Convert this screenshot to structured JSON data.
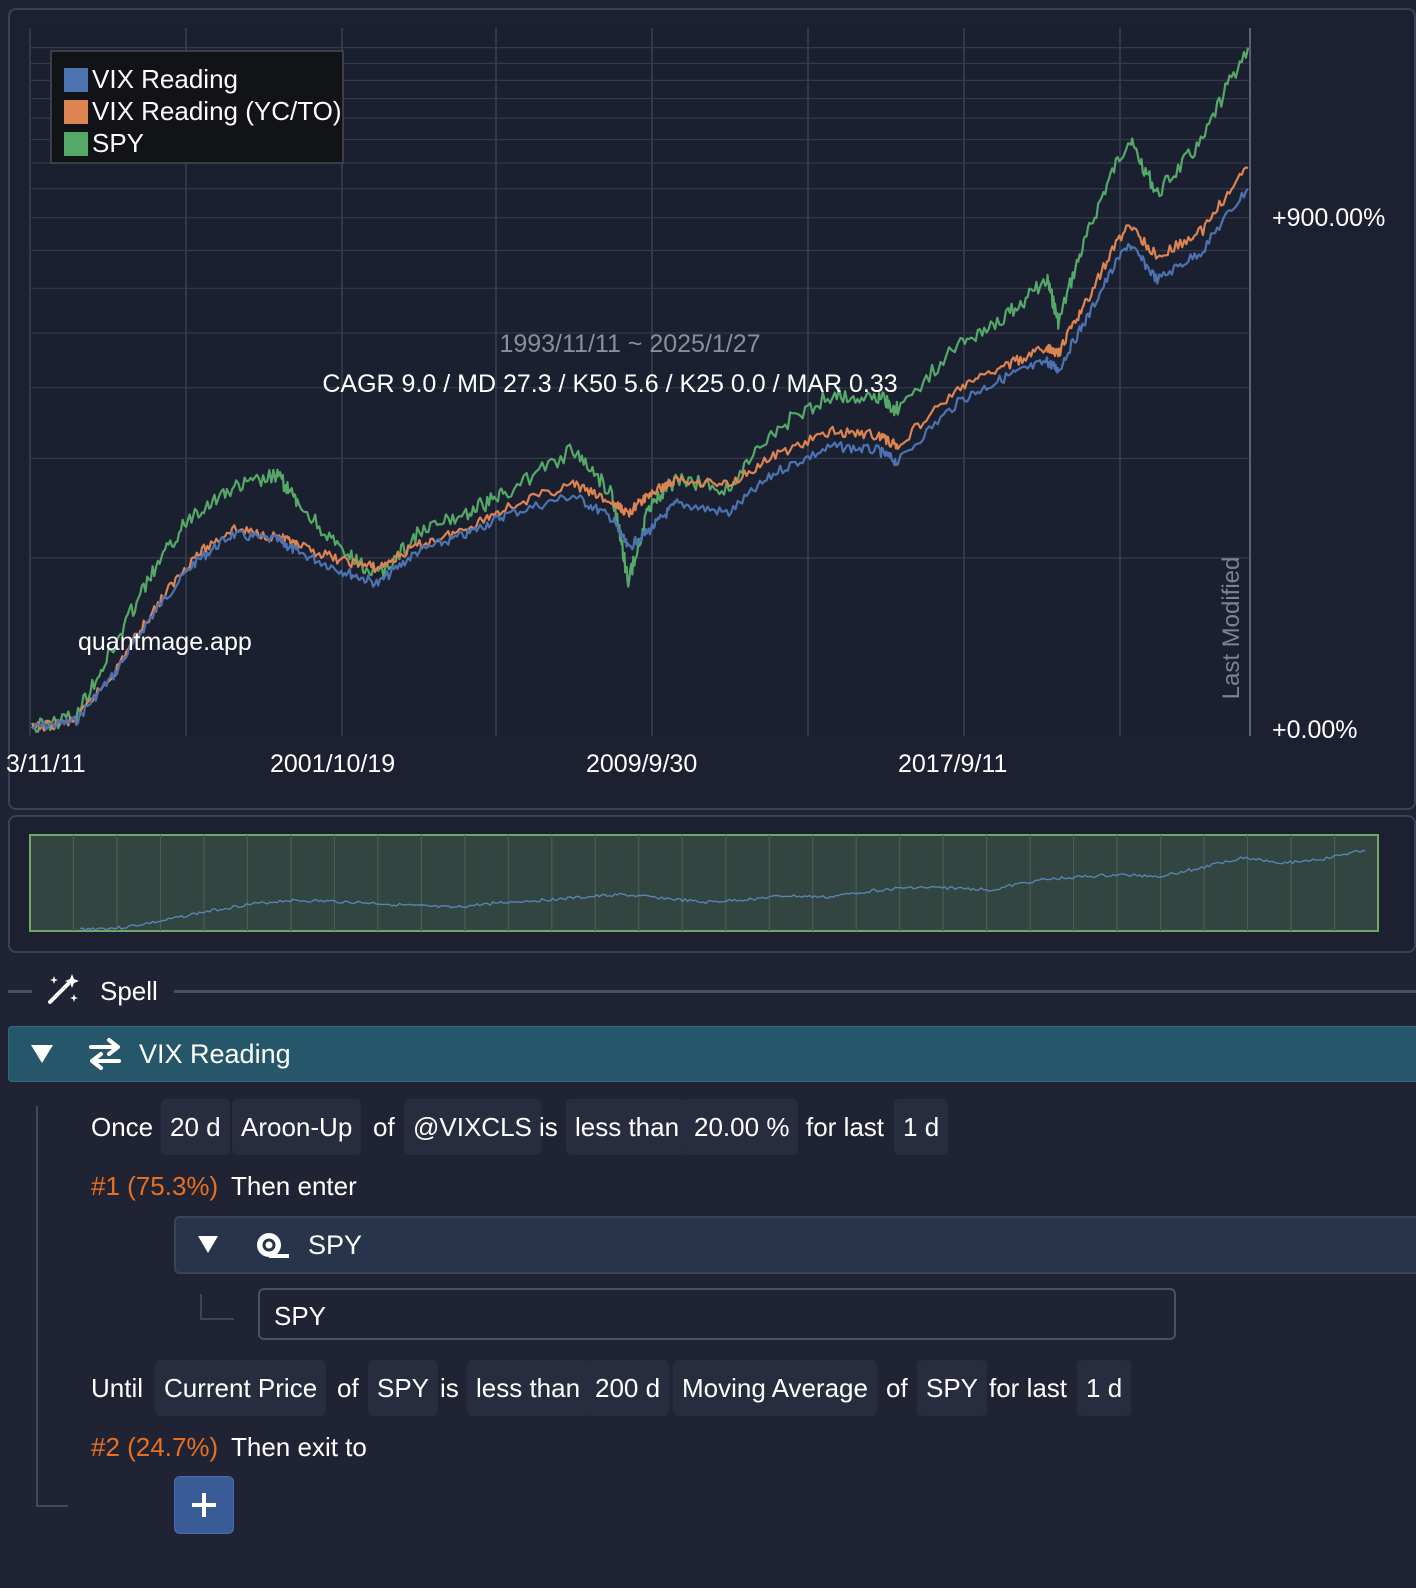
{
  "chart": {
    "legend": [
      {
        "label": "VIX Reading",
        "color": "#4c72b0"
      },
      {
        "label": "VIX Reading (YC/TO)",
        "color": "#dd8452"
      },
      {
        "label": "SPY",
        "color": "#55a868"
      }
    ],
    "date_range": "1993/11/11 ~ 2025/1/27",
    "stats": "CAGR 9.0 / MD 27.3 / K50 5.6 / K25 0.0 / MAR 0.33",
    "watermark": "quantmage.app",
    "last_modified_label": "Last Modified",
    "y_labels": [
      "+900.00%",
      "+0.00%"
    ],
    "x_labels": [
      "3/11/11",
      "2001/10/19",
      "2009/9/30",
      "2017/9/11"
    ]
  },
  "chart_data": {
    "type": "line",
    "title": "",
    "xlabel": "",
    "ylabel": "",
    "y_scale": "log",
    "y_ticks": [
      "+0.00%",
      "+900.00%"
    ],
    "x": [
      "1993/11/11",
      "1995/1/1",
      "1996/1/1",
      "1997/1/1",
      "1998/1/1",
      "1999/1/1",
      "2000/3/1",
      "2000/9/1",
      "2001/10/19",
      "2002/10/1",
      "2003/10/1",
      "2005/1/1",
      "2006/1/1",
      "2007/10/1",
      "2008/10/1",
      "2009/3/1",
      "2009/9/30",
      "2010/6/1",
      "2011/10/1",
      "2013/1/1",
      "2014/6/1",
      "2015/8/1",
      "2016/2/1",
      "2017/9/11",
      "2018/12/1",
      "2019/12/1",
      "2020/3/20",
      "2021/1/1",
      "2021/12/31",
      "2022/10/1",
      "2023/12/1",
      "2025/1/27"
    ],
    "series": [
      {
        "name": "VIX Reading",
        "values": [
          0,
          3,
          25,
          60,
          95,
          120,
          115,
          105,
          90,
          80,
          105,
          120,
          138,
          158,
          135,
          108,
          125,
          150,
          140,
          185,
          215,
          210,
          195,
          280,
          320,
          345,
          330,
          440,
          620,
          520,
          600,
          800
        ]
      },
      {
        "name": "VIX Reading (YC/TO)",
        "values": [
          0,
          3,
          26,
          62,
          100,
          125,
          118,
          110,
          98,
          92,
          110,
          125,
          145,
          170,
          150,
          140,
          160,
          175,
          170,
          205,
          235,
          230,
          215,
          300,
          340,
          370,
          360,
          480,
          680,
          580,
          660,
          880
        ]
      },
      {
        "name": "SPY",
        "values": [
          0,
          5,
          40,
          90,
          140,
          165,
          180,
          150,
          105,
          85,
          120,
          140,
          160,
          210,
          160,
          80,
          150,
          175,
          165,
          240,
          290,
          285,
          265,
          380,
          440,
          520,
          420,
          660,
          1000,
          780,
          990,
          1500
        ]
      }
    ]
  },
  "spell": {
    "label": "Spell"
  },
  "strategy": {
    "title": "VIX Reading",
    "condition1": [
      "Once",
      "20",
      "d",
      "Aroon-Up",
      "of",
      "@VIXCLS",
      "is",
      "less than",
      "20.00",
      "%",
      "for last",
      "1",
      "d"
    ],
    "branch1": {
      "tag": "#1 (75.3%)",
      "action": "Then enter"
    },
    "asset_group": {
      "title": "SPY",
      "item": "SPY"
    },
    "condition2": [
      "Until",
      "Current Price",
      "of",
      "SPY",
      "is",
      "less than",
      "200",
      "d",
      "Moving Average",
      "of",
      "SPY",
      "for last",
      "1",
      "d"
    ],
    "branch2": {
      "tag": "#2 (24.7%)",
      "action": "Then exit to"
    },
    "add_button": "+"
  }
}
